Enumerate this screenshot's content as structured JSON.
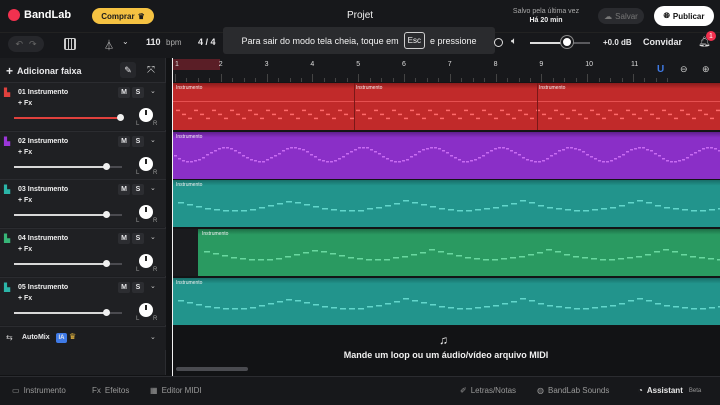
{
  "header": {
    "app_name": "BandLab",
    "buy_label": "Comprar",
    "project_title": "Projet",
    "save_status_line1": "Salvo pela última vez",
    "save_status_line2": "Há 20 min",
    "save_label": "Salvar",
    "publish_label": "Publicar"
  },
  "toolbar": {
    "bpm_value": "110",
    "bpm_unit": "bpm",
    "time_signature": "4 / 4",
    "fullscreen_tip_before": "Para sair do modo tela cheia, toque em",
    "fullscreen_tip_key": "Esc",
    "fullscreen_tip_after": "e pressione",
    "volume_db": "+0.0 dB",
    "invite_label": "Convidar",
    "notification_count": "1"
  },
  "left_panel": {
    "add_track_label": "Adicionar faixa",
    "tracks": [
      {
        "number": "01",
        "name": "Instrumento",
        "fx": "+ Fx",
        "mute": "M",
        "solo": "S",
        "left": "L",
        "right": "R",
        "color": "#e0413d",
        "volume": 0.98
      },
      {
        "number": "02",
        "name": "Instrumento",
        "fx": "+ Fx",
        "mute": "M",
        "solo": "S",
        "left": "L",
        "right": "R",
        "color": "#9b36d9",
        "volume": 0.85
      },
      {
        "number": "03",
        "name": "Instrumento",
        "fx": "+ Fx",
        "mute": "M",
        "solo": "S",
        "left": "L",
        "right": "R",
        "color": "#2bb5a8",
        "volume": 0.85
      },
      {
        "number": "04",
        "name": "Instrumento",
        "fx": "+ Fx",
        "mute": "M",
        "solo": "S",
        "left": "L",
        "right": "R",
        "color": "#37b577",
        "volume": 0.85
      },
      {
        "number": "05",
        "name": "Instrumento",
        "fx": "+ Fx",
        "mute": "M",
        "solo": "S",
        "left": "L",
        "right": "R",
        "color": "#2bb5a8",
        "volume": 0.85
      }
    ],
    "automix_label": "AutoMix",
    "automix_badge": "IA"
  },
  "timeline": {
    "ruler": [
      "1",
      "2",
      "3",
      "4",
      "5",
      "6",
      "7",
      "8",
      "9",
      "10",
      "11"
    ],
    "clip_label": "Instrumento",
    "clip_label_alt": "Instrumento",
    "drop_text": "Mande um loop ou um áudio/vídeo arquivo MIDI"
  },
  "bottom_bar": {
    "instrument_tab": "Instrumento",
    "effects_tab": "Efeitos",
    "midi_editor_tab": "Editor MIDI",
    "lyrics_tab": "Letras/Notas",
    "sounds_tab": "BandLab Sounds",
    "assistant_tab": "Assistant",
    "assistant_badge": "Beta"
  },
  "colors": {
    "brand_red": "#f2314f",
    "buy_yellow": "#f5c242",
    "accent_blue": "#3f7ae6"
  }
}
